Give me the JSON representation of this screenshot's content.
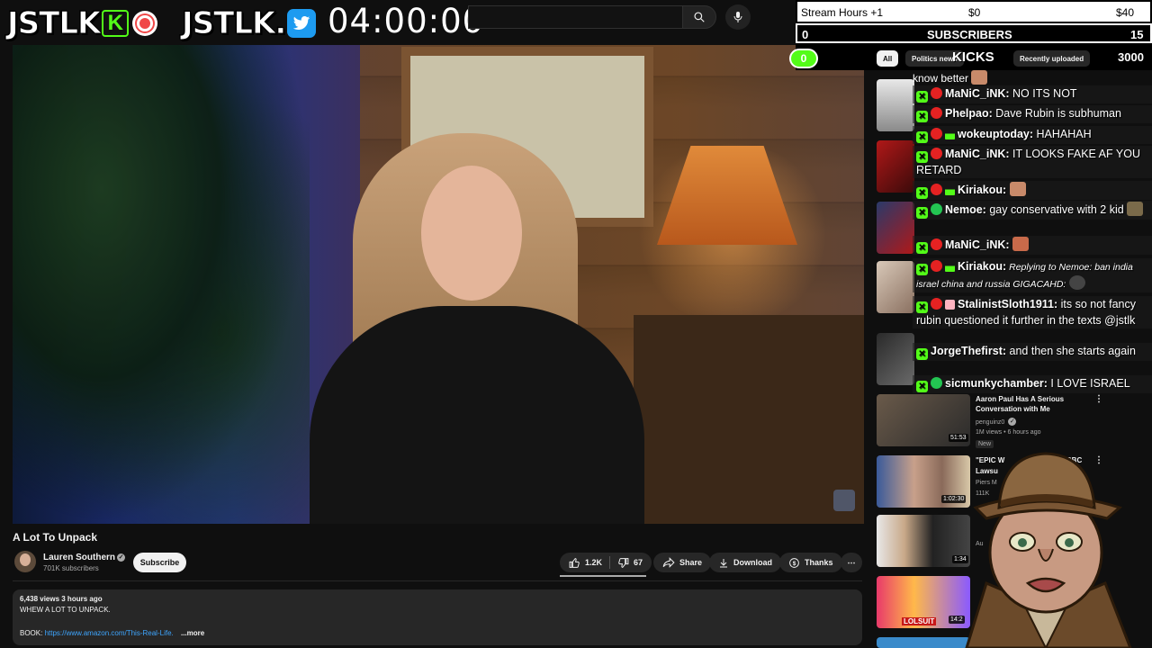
{
  "overlay": {
    "brand_left": "JSTLK",
    "kick_letter": "K",
    "brand_right": "JSTLK.",
    "timer": "04:00:00"
  },
  "stats": {
    "stream_hours_label": "Stream Hours +1",
    "money_current": "$0",
    "money_goal": "$40",
    "subs_count": "0",
    "subs_label": "SUBSCRIBERS",
    "subs_goal": "15",
    "kicks_count": "0",
    "kicks_label": "KICKS",
    "kicks_goal": "3000"
  },
  "filter_chips": [
    "All",
    "Politics news",
    "Recently uploaded"
  ],
  "video": {
    "title": "A Lot To Unpack",
    "channel": "Lauren Southern",
    "subscribers": "701K subscribers",
    "subscribe_label": "Subscribe",
    "likes": "1.2K",
    "dislikes": "67",
    "share_label": "Share",
    "download_label": "Download",
    "thanks_label": "Thanks",
    "views_time": "6,438 views  3 hours ago",
    "description_line": "WHEW A LOT TO UNPACK.",
    "book_label": "BOOK:",
    "book_link": "https://www.amazon.com/This-Real-Life.",
    "more_label": "...more"
  },
  "chat": {
    "partial_top": "know better",
    "messages": [
      {
        "name": "MaNiC_iNK:",
        "text": " NO ITS NOT"
      },
      {
        "name": "Phelpao:",
        "text": " Dave Rubin is subhuman"
      },
      {
        "name": "wokeuptoday:",
        "text": " HAHAHAH"
      },
      {
        "name": "MaNiC_iNK:",
        "text": " IT LOOKS FAKE AF YOU RETARD"
      },
      {
        "name": "Kiriakou:",
        "text": ""
      },
      {
        "name": "Nemoe:",
        "text": " gay conservative with 2 kid"
      },
      {
        "name": "MaNiC_iNK:",
        "text": ""
      },
      {
        "name": "Kiriakou:",
        "reply": " Replying to Nemoe: ban india israel china and russia GIGACAHD:"
      },
      {
        "name": "StalinistSloth1911:",
        "text": " its so not fancy rubin questioned it further in the texts @jstlk"
      },
      {
        "name": "JorgeThefirst:",
        "text": " and then she starts again"
      },
      {
        "name": "sicmunkychamber:",
        "text": " I LOVE ISRAEL"
      }
    ]
  },
  "recommended": [
    {
      "title": "Aaron Paul Has A Serious Conversation with Me",
      "channel": "penguinz0",
      "meta": "1M views • 6 hours ago",
      "duration": "51:53",
      "badge": "New"
    },
    {
      "title": "\"EPIC W",
      "title_end": "illion BBC",
      "title2": "Lawsu",
      "channel": "Piers M",
      "meta": "111K",
      "duration": "1:02:30"
    },
    {
      "title": "",
      "channel": "Au",
      "duration": "1:34"
    },
    {
      "title": "",
      "channel": "",
      "duration": "14:2",
      "thumb_text": "LOLSUIT"
    }
  ],
  "colors": {
    "kick_green": "#53fc18",
    "youtube_bg": "#0f0f0f",
    "link_blue": "#3ea6ff",
    "twitter_blue": "#1d9bf0"
  }
}
